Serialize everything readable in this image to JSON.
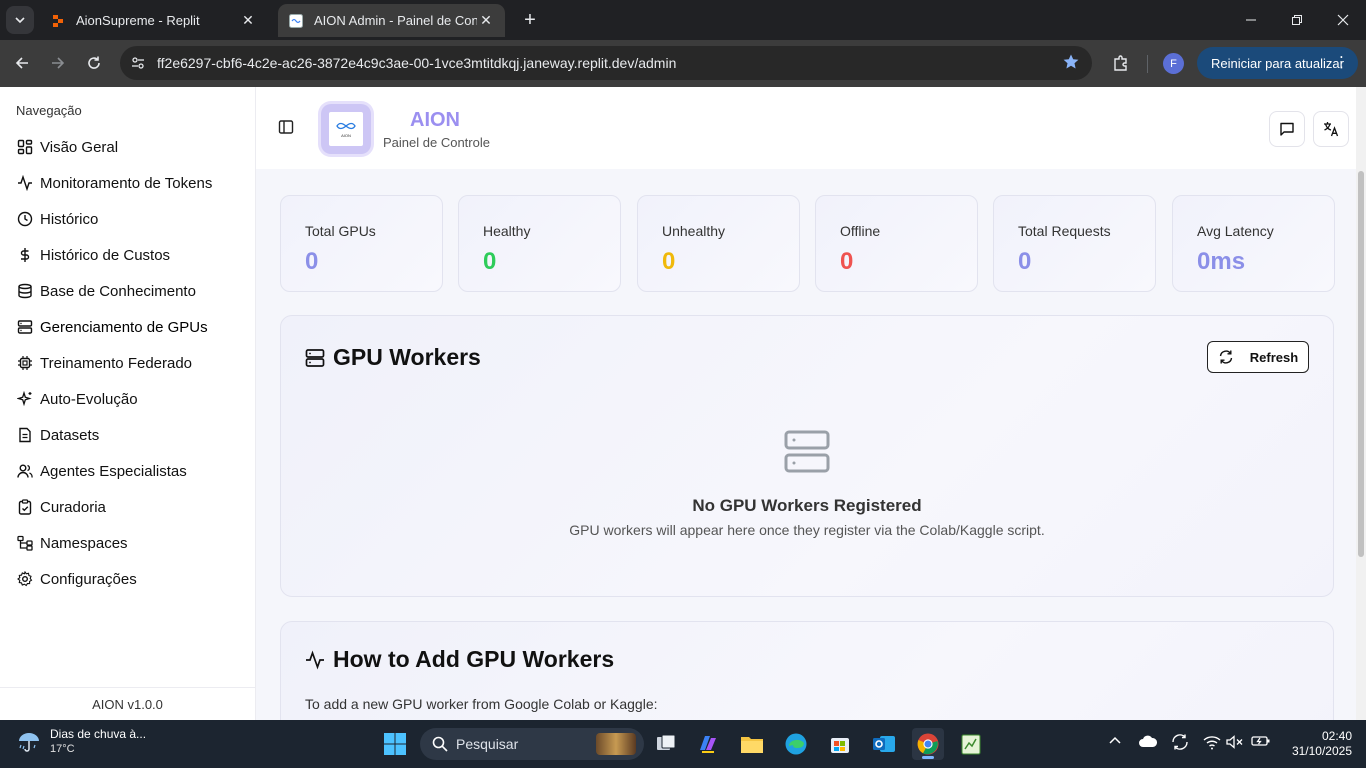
{
  "browser": {
    "tabs": [
      {
        "title": "AionSupreme - Replit",
        "active": false
      },
      {
        "title": "AION Admin - Painel de Controle",
        "active": true
      }
    ],
    "url": "ff2e6297-cbf6-4c2e-ac26-3872e4c9c3ae-00-1vce3mtitdkqj.janeway.replit.dev/admin",
    "profile_initial": "F",
    "update_label": "Reiniciar para atualizar"
  },
  "sidebar": {
    "heading": "Navegação",
    "items": [
      {
        "label": "Visão Geral",
        "icon": "grid-icon"
      },
      {
        "label": "Monitoramento de Tokens",
        "icon": "activity-icon"
      },
      {
        "label": "Histórico",
        "icon": "clock-icon"
      },
      {
        "label": "Histórico de Custos",
        "icon": "dollar-icon"
      },
      {
        "label": "Base de Conhecimento",
        "icon": "database-icon"
      },
      {
        "label": "Gerenciamento de GPUs",
        "icon": "server-icon",
        "active": true
      },
      {
        "label": "Treinamento Federado",
        "icon": "cpu-icon"
      },
      {
        "label": "Auto-Evolução",
        "icon": "sparkles-icon"
      },
      {
        "label": "Datasets",
        "icon": "file-icon"
      },
      {
        "label": "Agentes Especialistas",
        "icon": "users-icon"
      },
      {
        "label": "Curadoria",
        "icon": "clipboard-check-icon"
      },
      {
        "label": "Namespaces",
        "icon": "network-icon"
      },
      {
        "label": "Configurações",
        "icon": "gear-icon"
      }
    ],
    "footer": "AION v1.0.0"
  },
  "header": {
    "title": "AION",
    "subtitle": "Painel de Controle",
    "logo_text": "AION"
  },
  "stats": [
    {
      "label": "Total GPUs",
      "value": "0",
      "color": "#8b8fe8"
    },
    {
      "label": "Healthy",
      "value": "0",
      "color": "#2ecc5a"
    },
    {
      "label": "Unhealthy",
      "value": "0",
      "color": "#f0b90b"
    },
    {
      "label": "Offline",
      "value": "0",
      "color": "#ef5350"
    },
    {
      "label": "Total Requests",
      "value": "0",
      "color": "#8b8fe8"
    },
    {
      "label": "Avg Latency",
      "value": "0ms",
      "color": "#8b8fe8"
    }
  ],
  "workers": {
    "title": "GPU Workers",
    "refresh_label": "Refresh",
    "empty_title": "No GPU Workers Registered",
    "empty_subtitle": "GPU workers will appear here once they register via the Colab/Kaggle script."
  },
  "howto": {
    "title": "How to Add GPU Workers",
    "intro": "To add a new GPU worker from Google Colab or Kaggle:"
  },
  "taskbar": {
    "weather_title": "Dias de chuva à...",
    "weather_temp": "17°C",
    "search_placeholder": "Pesquisar",
    "time": "02:40",
    "date": "31/10/2025"
  }
}
